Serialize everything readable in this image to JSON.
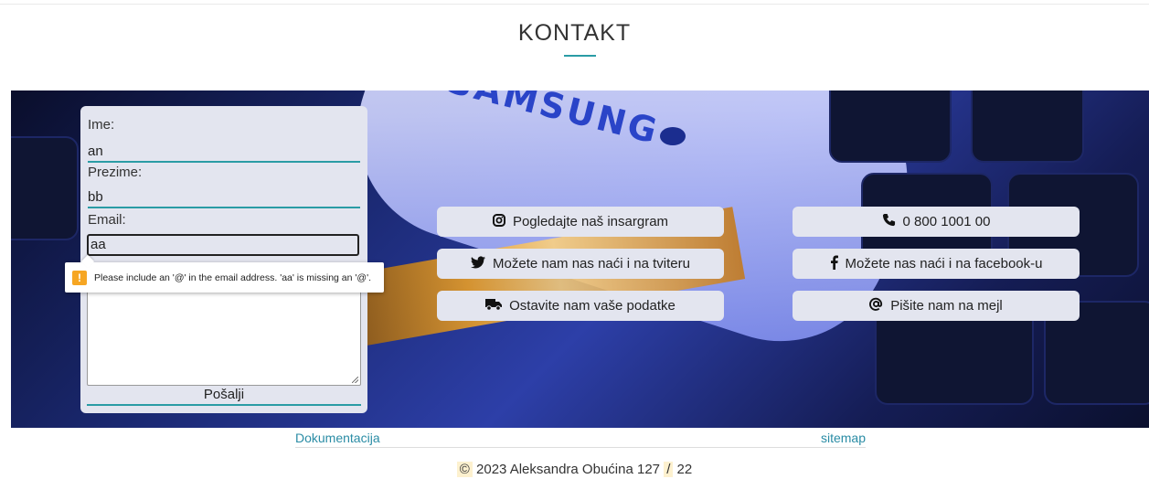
{
  "header": {
    "title": "KONTAKT"
  },
  "form": {
    "first_name_label": "Ime:",
    "first_name_value": "an",
    "last_name_label": "Prezime:",
    "last_name_value": "bb",
    "email_label": "Email:",
    "email_value": "aa",
    "message_value": "",
    "submit_label": "Pošalji",
    "validation_message": "Please include an '@' in the email address. 'aa' is missing an '@'."
  },
  "contact_buttons": [
    {
      "label": "Pogledajte naš insargram",
      "icon": "instagram-icon"
    },
    {
      "label": "0 800 1001 00",
      "icon": "phone-icon"
    },
    {
      "label": "Možete nam nas naći i na tviteru",
      "icon": "twitter-icon"
    },
    {
      "label": "Možete nas naći i na facebook-u",
      "icon": "facebook-icon"
    },
    {
      "label": "Ostavite nam vaše podatke",
      "icon": "truck-icon"
    },
    {
      "label": "Pišite nam na mejl",
      "icon": "at-icon"
    }
  ],
  "background": {
    "brand_text": "SAMSUNG"
  },
  "footer": {
    "doc_link": "Dokumentacija",
    "sitemap_link": "sitemap",
    "copyright_symbol": "©",
    "copyright_text": "2023 Aleksandra Obućina",
    "index_number": "127",
    "index_separator": "/",
    "index_year": "22"
  },
  "colors": {
    "accent": "#2a9ca5",
    "panel": "#e3e5ef",
    "warning": "#f6a623"
  }
}
